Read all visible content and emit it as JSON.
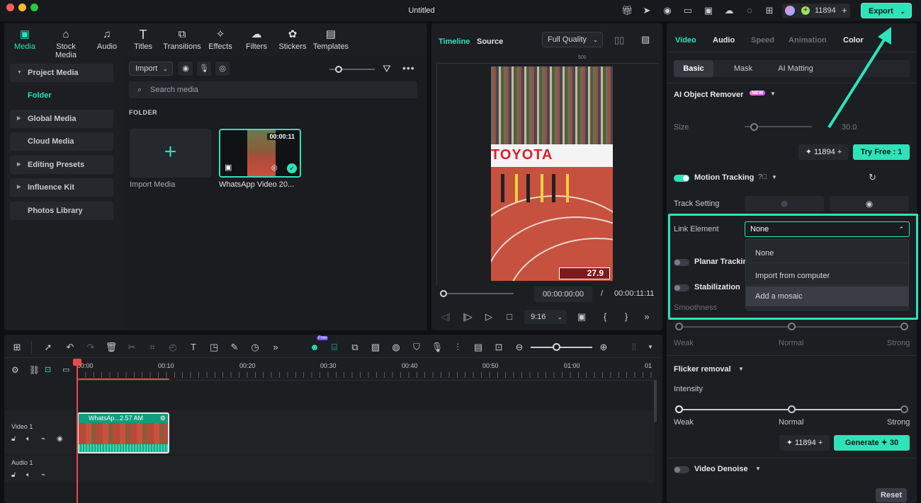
{
  "window": {
    "title": "Untitled",
    "credits": "11894",
    "export_label": "Export"
  },
  "colors": {
    "accent": "#2de3b8",
    "bg": "#1c1e22",
    "highlight_border": "#2de3b8"
  },
  "toolbar": [
    {
      "label": "Media",
      "icon": "media-icon"
    },
    {
      "label": "Stock Media",
      "icon": "stock-media-icon"
    },
    {
      "label": "Audio",
      "icon": "audio-icon"
    },
    {
      "label": "Titles",
      "icon": "titles-icon"
    },
    {
      "label": "Transitions",
      "icon": "transitions-icon"
    },
    {
      "label": "Effects",
      "icon": "effects-icon"
    },
    {
      "label": "Filters",
      "icon": "filters-icon"
    },
    {
      "label": "Stickers",
      "icon": "stickers-icon"
    },
    {
      "label": "Templates",
      "icon": "templates-icon"
    }
  ],
  "sidebar": {
    "items": [
      "Project Media",
      "Global Media",
      "Cloud Media",
      "Editing Presets",
      "Influence Kit",
      "Photos Library"
    ],
    "folder": "Folder"
  },
  "media": {
    "import_label": "Import",
    "search_placeholder": "Search media",
    "folder_heading": "FOLDER",
    "import_media_label": "Import Media",
    "video_name": "WhatsApp Video 20...",
    "video_duration": "00:00:11"
  },
  "preview": {
    "tab_timeline": "Timeline",
    "tab_source": "Source",
    "quality": "Full Quality",
    "ruler_mark": "500",
    "current_time": "00:00:00:00",
    "separator": "/",
    "total_time": "00:00:11:11",
    "ratio": "9:16",
    "toyota_text": "TOYOTA",
    "clock": "27.9"
  },
  "right_panel": {
    "tabs": [
      "Video",
      "Audio",
      "Speed",
      "Animation",
      "Color"
    ],
    "subtabs": [
      "Basic",
      "Mask",
      "AI Matting"
    ],
    "ai_object_remover": "AI Object Remover",
    "new_badge": "NEW",
    "size_label": "Size",
    "size_value": "30.0",
    "credits": "11894",
    "try_free": "Try Free : 1",
    "motion_tracking": "Motion Tracking",
    "track_setting": "Track Setting",
    "link_element": "Link Element",
    "link_value": "None",
    "dropdown_options": [
      "None",
      "Import from computer",
      "Add a mosaic"
    ],
    "planar_tracking": "Planar Trackin",
    "stabilization": "Stabilization",
    "smoothness": "Smoothness",
    "smooth_levels": [
      "Weak",
      "Normal",
      "Strong"
    ],
    "flicker_removal": "Flicker removal",
    "intensity": "Intensity",
    "intensity_levels": [
      "Weak",
      "Normal",
      "Strong"
    ],
    "generate_label": "Generate",
    "generate_cost": "30",
    "video_denoise": "Video Denoise",
    "reset_label": "Reset"
  },
  "timeline": {
    "ticks": [
      "00:00",
      "00:10",
      "00:20",
      "00:30",
      "00:40",
      "00:50",
      "01:00",
      "01"
    ],
    "video_track": "Video 1",
    "audio_track": "Audio 1",
    "clip_label": "WhatsAp...2.57 AM",
    "free_badge": "Free"
  }
}
